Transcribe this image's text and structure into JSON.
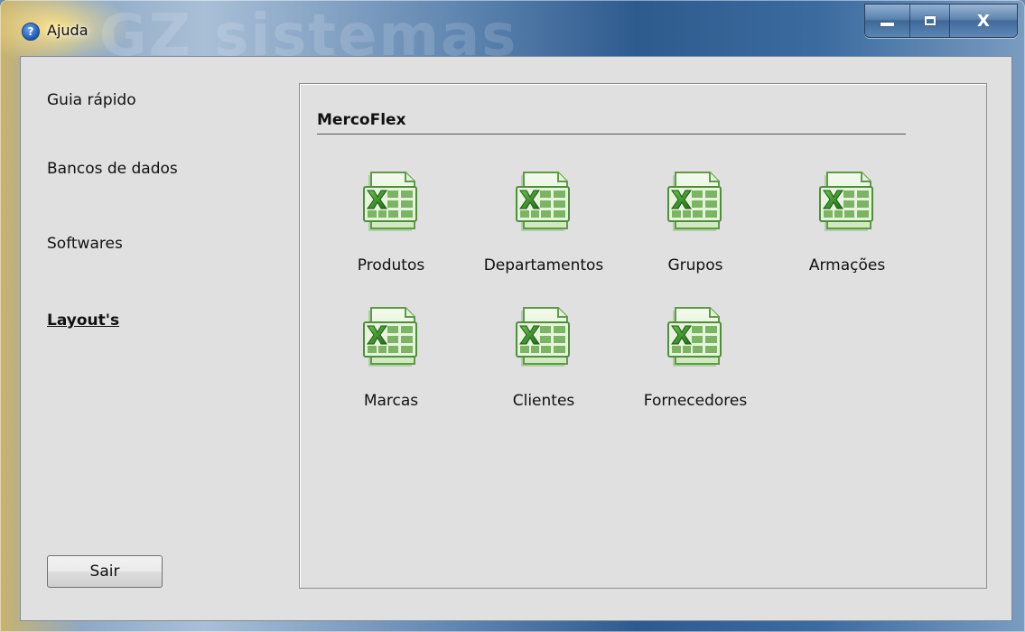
{
  "window": {
    "title": "Ajuda",
    "background_watermark": "GZ sistemas",
    "help_glyph": "?",
    "close_glyph": "X"
  },
  "sidebar": {
    "items": [
      {
        "label": "Guia rápido",
        "active": false
      },
      {
        "label": "Bancos de dados",
        "active": false
      },
      {
        "label": "Softwares",
        "active": false
      },
      {
        "label": "Layout's",
        "active": true
      }
    ],
    "exit_label": "Sair"
  },
  "content": {
    "title": "MercoFlex",
    "files": [
      {
        "label": "Produtos",
        "icon": "excel-file-icon"
      },
      {
        "label": "Departamentos",
        "icon": "excel-file-icon"
      },
      {
        "label": "Grupos",
        "icon": "excel-file-icon"
      },
      {
        "label": "Armações",
        "icon": "excel-file-icon"
      },
      {
        "label": "Marcas",
        "icon": "excel-file-icon"
      },
      {
        "label": "Clientes",
        "icon": "excel-file-icon"
      },
      {
        "label": "Fornecedores",
        "icon": "excel-file-icon"
      }
    ]
  },
  "colors": {
    "client_background": "#e0e0e0",
    "excel_green": "#3a8a2a",
    "title_bar_blue": "#2e5b8e"
  }
}
